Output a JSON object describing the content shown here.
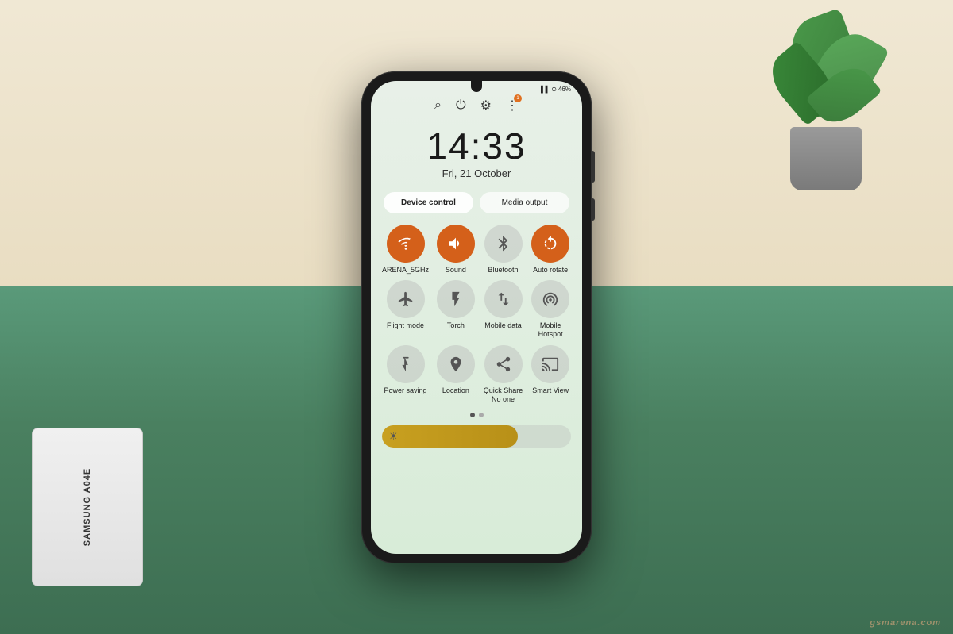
{
  "scene": {
    "watermark": "gsmarena.com"
  },
  "phone": {
    "status_bar": {
      "signal": "▌▌▌",
      "wifi": "⊙",
      "battery": "46%"
    },
    "top_actions": [
      {
        "icon": "⌕",
        "name": "search-icon"
      },
      {
        "icon": "⏻",
        "name": "power-icon"
      },
      {
        "icon": "⚙",
        "name": "settings-icon"
      },
      {
        "icon": "⋮",
        "name": "more-icon",
        "badge": "1"
      }
    ],
    "clock": {
      "time": "14:33",
      "date": "Fri, 21 October"
    },
    "control_buttons": [
      {
        "label": "Device control",
        "active": true
      },
      {
        "label": "Media output",
        "active": false
      }
    ],
    "quick_tiles": [
      {
        "icon": "📶",
        "label": "ARENA_5GHz",
        "active": true,
        "icon_char": "WiFi"
      },
      {
        "icon": "🔊",
        "label": "Sound",
        "active": true,
        "icon_char": "Sound"
      },
      {
        "icon": "Ⓑ",
        "label": "Bluetooth",
        "active": false,
        "icon_char": "BT"
      },
      {
        "icon": "⟳",
        "label": "Auto rotate",
        "active": true,
        "icon_char": "Rotate"
      },
      {
        "icon": "✈",
        "label": "Flight mode",
        "active": false,
        "icon_char": "Plane"
      },
      {
        "icon": "🔦",
        "label": "Torch",
        "active": false,
        "icon_char": "Torch"
      },
      {
        "icon": "↑↓",
        "label": "Mobile data",
        "active": false,
        "icon_char": "Data"
      },
      {
        "icon": "📡",
        "label": "Mobile Hotspot",
        "active": false,
        "icon_char": "Hotspot"
      },
      {
        "icon": "🏠",
        "label": "Power saving",
        "active": false,
        "icon_char": "PowerSave"
      },
      {
        "icon": "📍",
        "label": "Location",
        "active": false,
        "icon_char": "Location"
      },
      {
        "icon": "↗",
        "label": "Quick Share\nNo one",
        "active": false,
        "icon_char": "Share"
      },
      {
        "icon": "👁",
        "label": "Smart View",
        "active": false,
        "icon_char": "SmartView"
      }
    ],
    "brightness": {
      "level": 72,
      "icon": "☀"
    },
    "page_dots": [
      {
        "active": true
      },
      {
        "active": false
      }
    ]
  }
}
